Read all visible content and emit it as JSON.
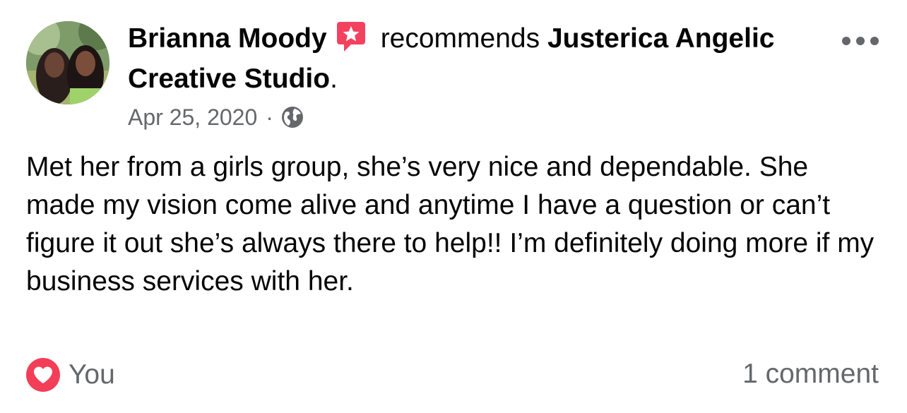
{
  "post": {
    "author": "Brianna Moody",
    "verb": "recommends",
    "page_name": "Justerica Angelic Creative Studio",
    "period": ".",
    "date": "Apr 25, 2020",
    "separator": "·",
    "privacy_icon": "globe-icon",
    "body": "Met her from a girls group, she’s very nice and dependable. She made my vision come alive and anytime I have a question or can’t figure it out she’s always there to help!! I’m definitely doing more if my business services with her."
  },
  "reactions": {
    "icon": "heart-icon",
    "reactors": "You"
  },
  "comments": {
    "label": "1 comment"
  },
  "colors": {
    "accent_red": "#f33e58",
    "secondary_text": "#65676b",
    "primary_text": "#050505",
    "recommend_badge": "#f3425f"
  }
}
